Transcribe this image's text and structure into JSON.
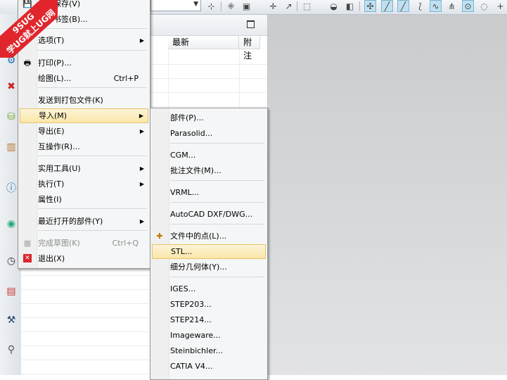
{
  "watermark": {
    "line1": "9SUG",
    "line2": "学UG就上UG网"
  },
  "toolbar": {
    "icons": [
      "view-triad-icon",
      "snap-icon",
      "select-filter-icon",
      "box-select-icon",
      "shade-icon",
      "cube-icon",
      "point-snap-icon",
      "line-snap-icon",
      "arc-snap-icon",
      "curve-snap-icon",
      "intersect-icon",
      "center-icon",
      "quadrant-icon",
      "plus-icon"
    ]
  },
  "navigator": {
    "col_latest": "最新",
    "col_note": "附注"
  },
  "file_menu": {
    "items": [
      {
        "label": "全部保存(V)"
      },
      {
        "label": "保存书签(B)..."
      },
      {
        "label": "选项(T)"
      },
      {
        "label": "打印(P)..."
      },
      {
        "label": "绘图(L)...",
        "shortcut": "Ctrl+P"
      },
      {
        "label": "发送到打包文件(K)"
      },
      {
        "label": "导入(M)"
      },
      {
        "label": "导出(E)"
      },
      {
        "label": "互操作(R)..."
      },
      {
        "label": "实用工具(U)"
      },
      {
        "label": "执行(T)"
      },
      {
        "label": "属性(I)"
      },
      {
        "label": "最近打开的部件(Y)"
      },
      {
        "label": "完成草图(K)",
        "shortcut": "Ctrl+Q"
      },
      {
        "label": "退出(X)"
      }
    ]
  },
  "import_menu": {
    "items": [
      {
        "label": "部件(P)..."
      },
      {
        "label": "Parasolid..."
      },
      {
        "label": "CGM..."
      },
      {
        "label": "批注文件(M)..."
      },
      {
        "label": "VRML..."
      },
      {
        "label": "AutoCAD DXF/DWG..."
      },
      {
        "label": "文件中的点(L)..."
      },
      {
        "label": "STL..."
      },
      {
        "label": "细分几何体(Y)..."
      },
      {
        "label": "IGES..."
      },
      {
        "label": "STEP203..."
      },
      {
        "label": "STEP214..."
      },
      {
        "label": "Imageware..."
      },
      {
        "label": "Steinbichler..."
      },
      {
        "label": "CATIA V4..."
      }
    ]
  }
}
